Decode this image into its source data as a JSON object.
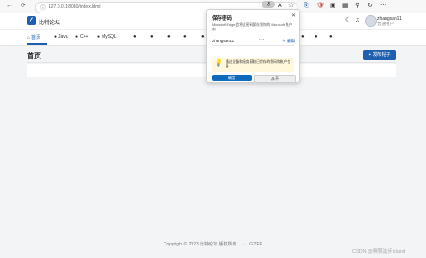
{
  "browser": {
    "back": "←",
    "refresh": "⟳",
    "lock": "ⓘ",
    "url": "127.0.0.1:8080/index.html",
    "key_icon": "⚷",
    "icons": [
      "A",
      "☆",
      "⎘",
      "🛡",
      "▣",
      "▦",
      "⚲",
      "↻",
      "⋯"
    ]
  },
  "site": {
    "logo_text": "✓",
    "name": "比特论坛",
    "user_name": "zhangsan11",
    "user_role": "普通用户"
  },
  "nav": {
    "tabs": [
      {
        "label": "首页",
        "icon": "⌂"
      },
      {
        "label": "Java",
        "icon": "●"
      },
      {
        "label": "C++",
        "icon": "●"
      },
      {
        "label": "MySQL",
        "icon": "●"
      }
    ],
    "extra_dots": [
      "●",
      "●",
      "●",
      "●",
      "●",
      "●",
      "●",
      "●"
    ]
  },
  "main": {
    "title": "首页",
    "post_button": "+ 发布帖子"
  },
  "footer": {
    "copyright": "Copyright © 2023 比特论坛 版权所有",
    "separator": "·",
    "link": "GITEE"
  },
  "watermark": "CSDN @無限進步island",
  "popup": {
    "title": "保存密码",
    "description": "Microsoft Edge 会将此密码保存到你的 Microsoft 帐户中",
    "username": "zhangsan11",
    "password_mask": "•••",
    "edit_label": "✎ 编辑",
    "tip": "通过设备和服务获取已保存的密码和帐户信息",
    "save_button": "确定",
    "never_button": "从不"
  },
  "colors": {
    "brand": "#1f5fb0",
    "edge_button": "#0f6cbd",
    "tip_bg": "#fff8dc"
  }
}
